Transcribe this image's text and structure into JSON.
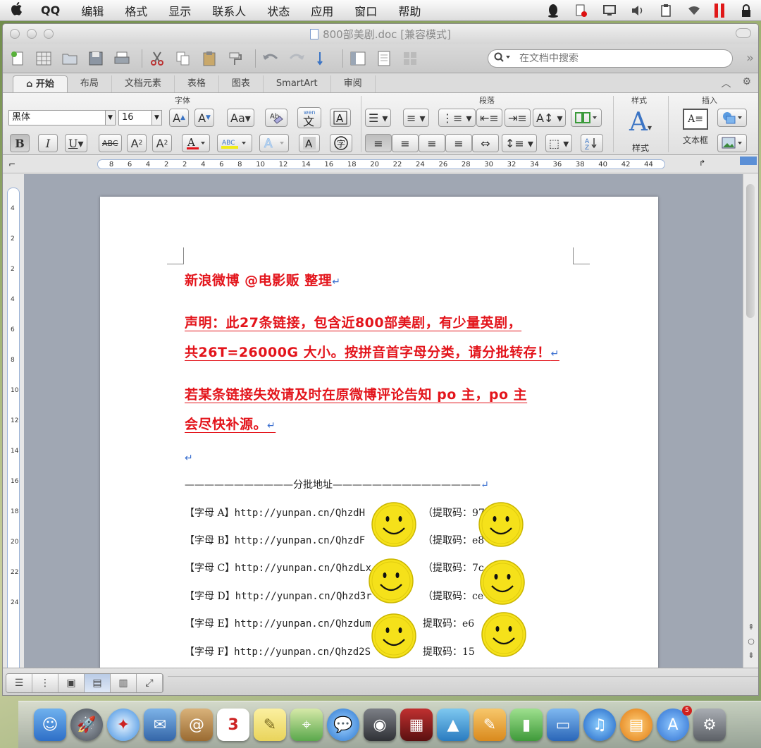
{
  "menubar": {
    "apple": "",
    "items": [
      "QQ",
      "编辑",
      "格式",
      "显示",
      "联系人",
      "状态",
      "应用",
      "窗口",
      "帮助"
    ]
  },
  "window": {
    "title": "800部美剧.doc [兼容模式]"
  },
  "search": {
    "placeholder": "在文档中搜索"
  },
  "ribbon": {
    "tabs": [
      "开始",
      "布局",
      "文档元素",
      "表格",
      "图表",
      "SmartArt",
      "审阅"
    ],
    "group_labels": {
      "font": "字体",
      "paragraph": "段落",
      "styles": "样式",
      "insert": "插入"
    },
    "font_name": "黑体",
    "font_size": "16",
    "styles_label": "样式",
    "textbox_label": "文本框"
  },
  "ruler": {
    "ticks": [
      "8",
      "6",
      "4",
      "2",
      "2",
      "4",
      "6",
      "8",
      "10",
      "12",
      "14",
      "16",
      "18",
      "20",
      "22",
      "24",
      "26",
      "28",
      "30",
      "32",
      "34",
      "36",
      "38",
      "40",
      "42",
      "44"
    ]
  },
  "vruler": {
    "ticks": [
      "4",
      "2",
      "2",
      "4",
      "6",
      "8",
      "10",
      "12",
      "14",
      "16",
      "18",
      "20",
      "22",
      "24"
    ]
  },
  "document": {
    "line1": "新浪微博 @电影贩 整理",
    "line2": "声明：此27条链接，包含近800部美剧，有少量英剧，",
    "line3": "共26T=26000G 大小。按拼音首字母分类，请分批转存！",
    "line4": "若某条链接失效请及时在原微博评论告知 po 主，po 主",
    "line5": "会尽快补源。",
    "divider": "———————————分批地址———————————————",
    "paragraph_mark": "↵",
    "links": [
      {
        "label": "【字母 A】",
        "url": "http://yunpan.cn/QhzdH",
        "code": "（提取码：97"
      },
      {
        "label": "【字母 B】",
        "url": "http://yunpan.cn/QhzdF",
        "code": "（提取码：e8"
      },
      {
        "label": "【字母 C】",
        "url": "http://yunpan.cn/QhzdLx",
        "code": "（提取码：7c"
      },
      {
        "label": "【字母 D】",
        "url": "http://yunpan.cn/Qhzd3r",
        "code": "（提取码：ce"
      },
      {
        "label": "【字母 E】",
        "url": "http://yunpan.cn/Qhzdum",
        "code": "提取码：e6"
      },
      {
        "label": "【字母 F】",
        "url": "http://yunpan.cn/Qhzd2S",
        "code": "提取码：15"
      }
    ]
  },
  "dock": {
    "badge_count": "5"
  },
  "colors": {
    "red_text": "#e3141b",
    "smiley_yellow": "#f5e11a",
    "accent_blue": "#3b74c4"
  }
}
